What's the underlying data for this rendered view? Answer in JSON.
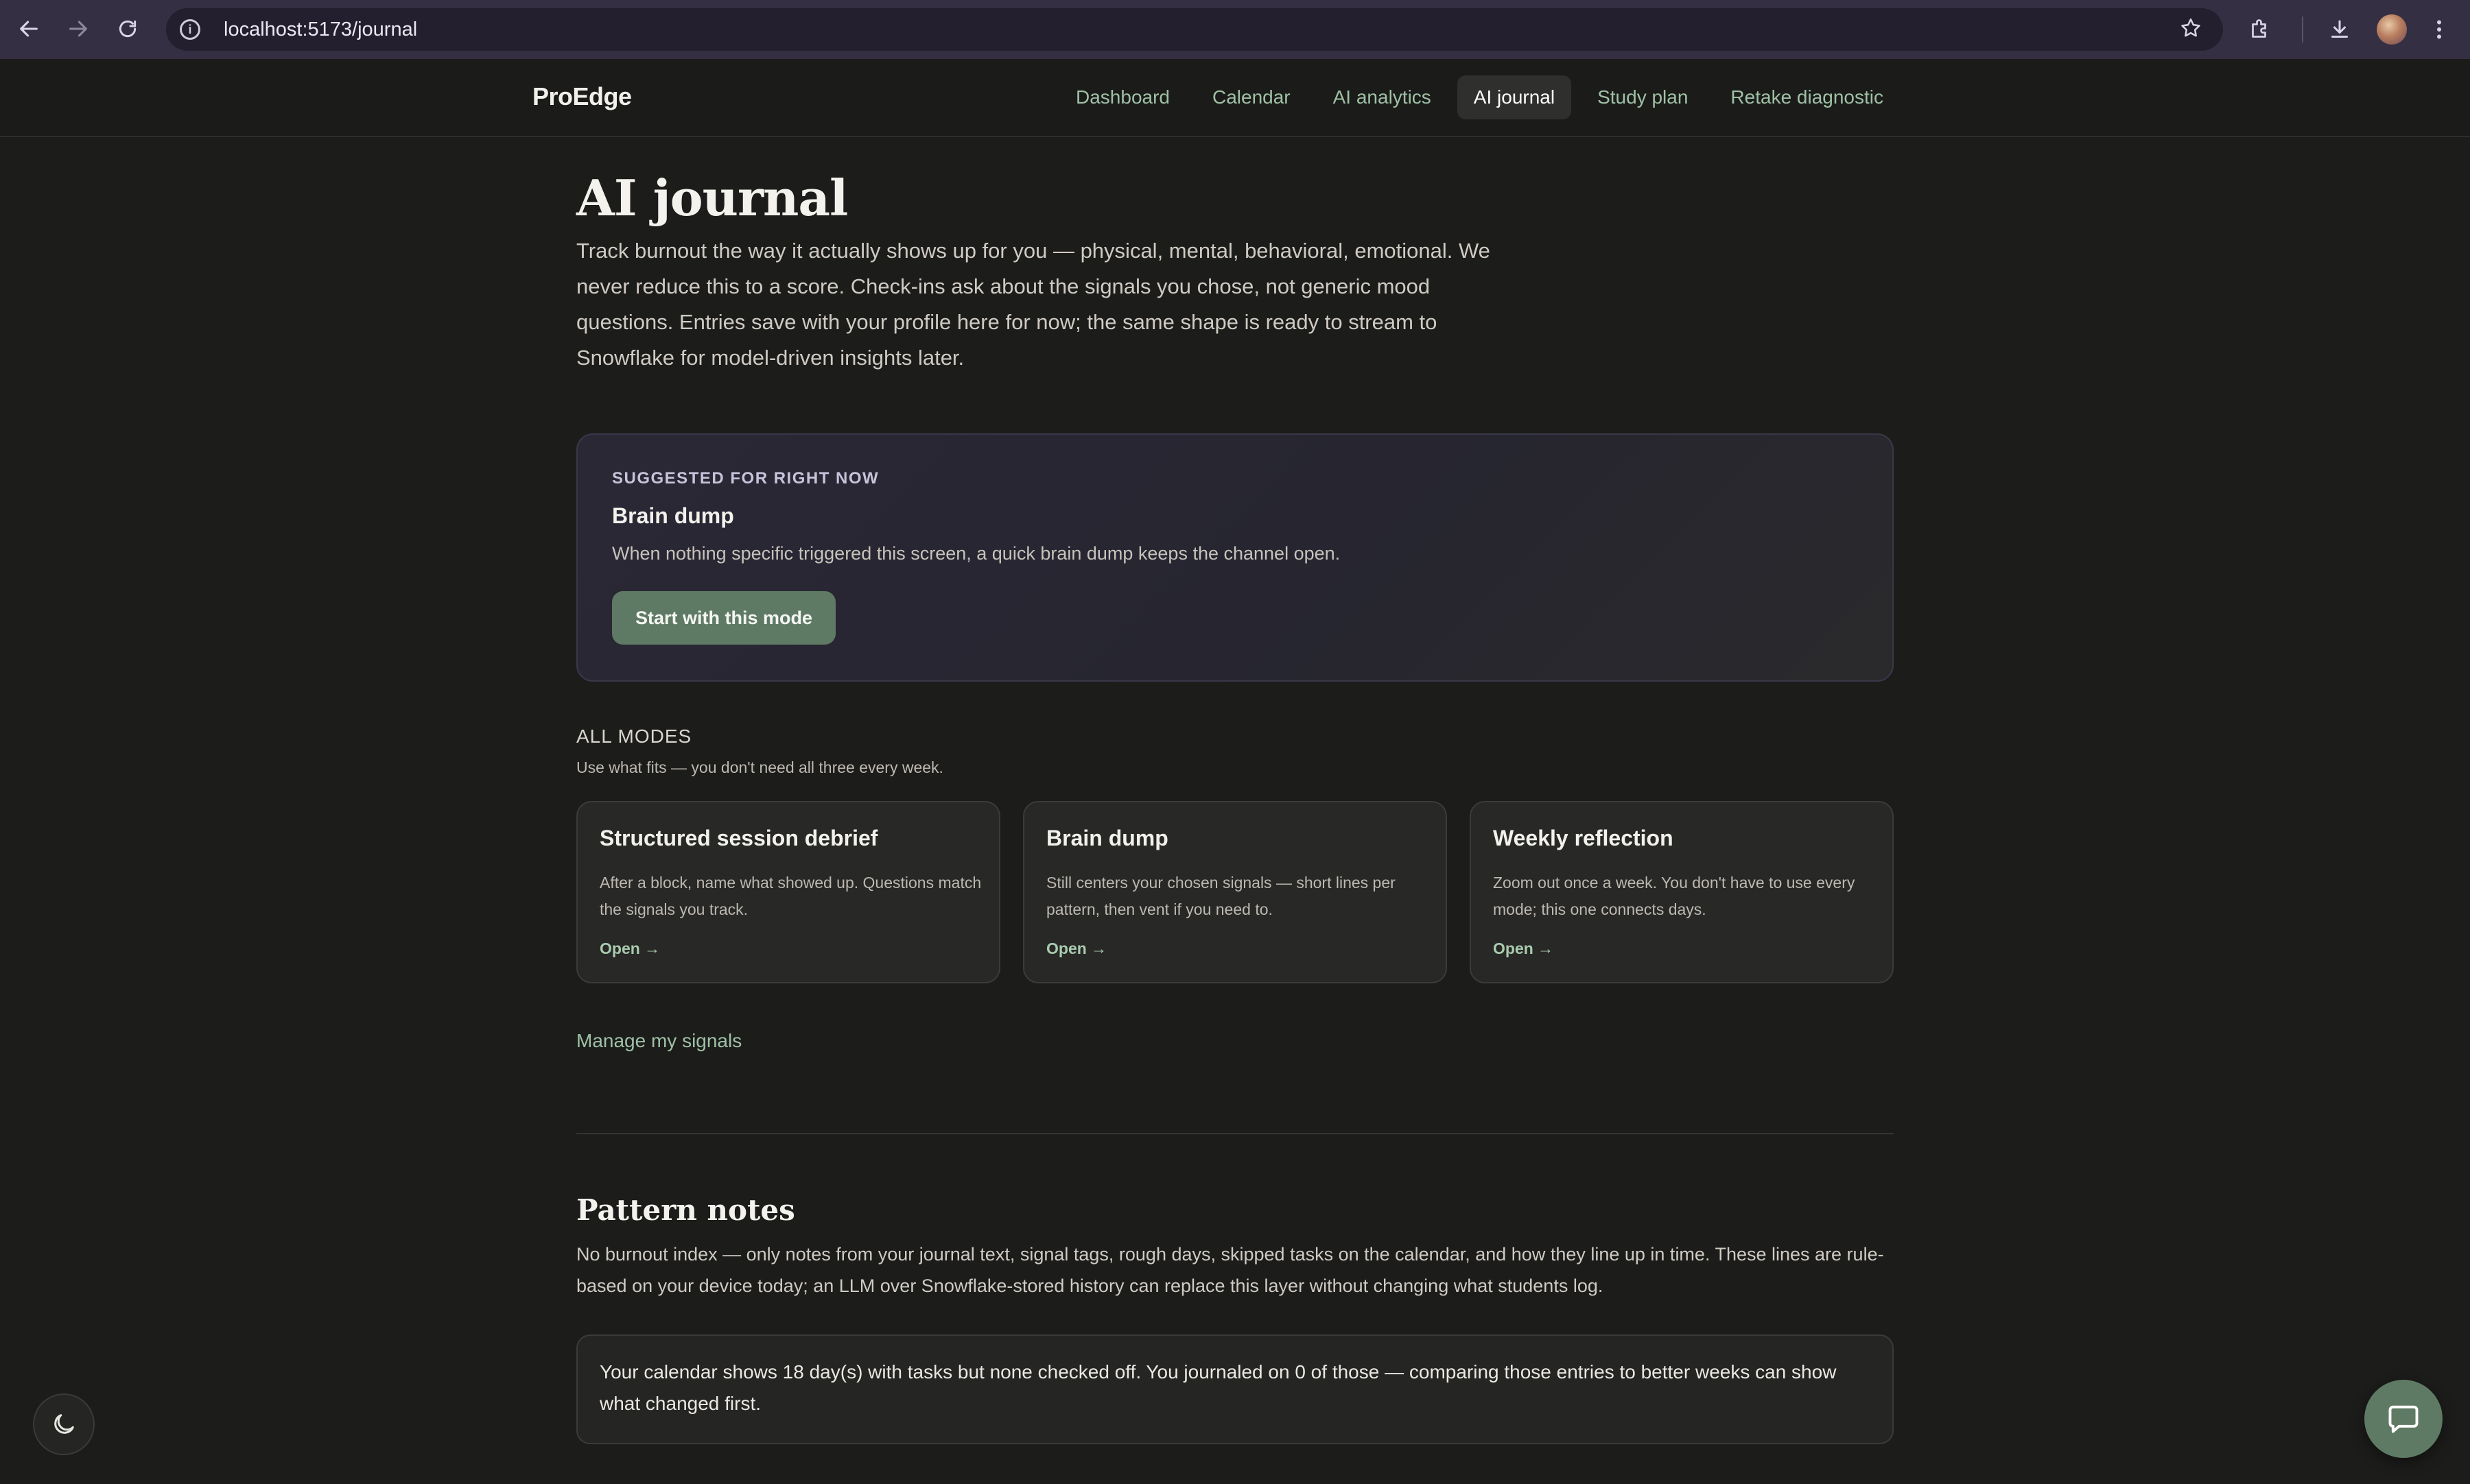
{
  "browser": {
    "url": "localhost:5173/journal"
  },
  "nav": {
    "brand": "ProEdge",
    "links": [
      {
        "label": "Dashboard",
        "active": false
      },
      {
        "label": "Calendar",
        "active": false
      },
      {
        "label": "AI analytics",
        "active": false
      },
      {
        "label": "AI journal",
        "active": true
      },
      {
        "label": "Study plan",
        "active": false
      },
      {
        "label": "Retake diagnostic",
        "active": false
      }
    ]
  },
  "page": {
    "title": "AI journal",
    "intro": "Track burnout the way it actually shows up for you — physical, mental, behavioral, emotional. We never reduce this to a score. Check-ins ask about the signals you chose, not generic mood questions. Entries save with your profile here for now; the same shape is ready to stream to Snowflake for model-driven insights later."
  },
  "suggested": {
    "eyebrow": "SUGGESTED FOR RIGHT NOW",
    "title": "Brain dump",
    "description": "When nothing specific triggered this screen, a quick brain dump keeps the channel open.",
    "button_label": "Start with this mode"
  },
  "modes": {
    "heading": "ALL MODES",
    "subheading": "Use what fits — you don't need all three every week.",
    "items": [
      {
        "title": "Structured session debrief",
        "description": "After a block, name what showed up. Questions match the signals you track.",
        "open_label": "Open →"
      },
      {
        "title": "Brain dump",
        "description": "Still centers your chosen signals — short lines per pattern, then vent if you need to.",
        "open_label": "Open →"
      },
      {
        "title": "Weekly reflection",
        "description": "Zoom out once a week. You don't have to use every mode; this one connects days.",
        "open_label": "Open →"
      }
    ]
  },
  "manage_signals_label": "Manage my signals",
  "pattern_notes": {
    "title": "Pattern notes",
    "description": "No burnout index — only notes from your journal text, signal tags, rough days, skipped tasks on the calendar, and how they line up in time. These lines are rule-based on your device today; an LLM over Snowflake-stored history can replace this layer without changing what students log.",
    "note": "Your calendar shows 18 day(s) with tasks but none checked off. You journaled on 0 of those — comparing those entries to better weeks can show what changed first."
  },
  "colors": {
    "accent": "#5f7a64",
    "link": "#9fc1a4",
    "background": "#1c1c1b"
  }
}
